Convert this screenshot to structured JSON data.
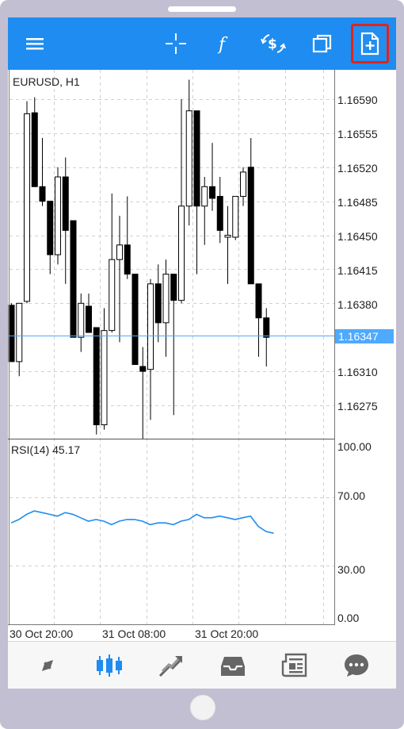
{
  "toolbar": {
    "icons": [
      "menu-icon",
      "crosshair-icon",
      "indicator-f-icon",
      "symbol-change-icon",
      "window-icon",
      "new-order-icon"
    ]
  },
  "chart": {
    "symbol_label": "EURUSD, H1",
    "rsi_label": "RSI(14) 45.17",
    "price_labels": [
      "1.16590",
      "1.16555",
      "1.16520",
      "1.16485",
      "1.16450",
      "1.16415",
      "1.16380",
      "1.16310",
      "1.16275"
    ],
    "current_price": "1.16347",
    "rsi_levels": [
      "100.00",
      "70.00",
      "30.00",
      "0.00"
    ],
    "time_labels": [
      "30 Oct 20:00",
      "31 Oct 08:00",
      "31 Oct 20:00"
    ]
  },
  "chart_data": {
    "type": "candlestick",
    "symbol": "EURUSD",
    "timeframe": "H1",
    "ylim": [
      1.1625,
      1.16615
    ],
    "current_price": 1.16347,
    "candles": [
      {
        "o": 1.16378,
        "h": 1.1638,
        "l": 1.1632,
        "c": 1.1632
      },
      {
        "o": 1.1632,
        "h": 1.1638,
        "l": 1.16305,
        "c": 1.1638
      },
      {
        "o": 1.16382,
        "h": 1.16588,
        "l": 1.1638,
        "c": 1.16575
      },
      {
        "o": 1.16576,
        "h": 1.16592,
        "l": 1.16508,
        "c": 1.165
      },
      {
        "o": 1.165,
        "h": 1.1655,
        "l": 1.1648,
        "c": 1.16485
      },
      {
        "o": 1.16485,
        "h": 1.16485,
        "l": 1.1641,
        "c": 1.1643
      },
      {
        "o": 1.1643,
        "h": 1.1652,
        "l": 1.1642,
        "c": 1.1651
      },
      {
        "o": 1.1651,
        "h": 1.1653,
        "l": 1.164,
        "c": 1.16455
      },
      {
        "o": 1.16465,
        "h": 1.16465,
        "l": 1.16345,
        "c": 1.16345
      },
      {
        "o": 1.16345,
        "h": 1.1639,
        "l": 1.1633,
        "c": 1.1638
      },
      {
        "o": 1.16377,
        "h": 1.1639,
        "l": 1.16355,
        "c": 1.1635
      },
      {
        "o": 1.16355,
        "h": 1.16355,
        "l": 1.16245,
        "c": 1.16255
      },
      {
        "o": 1.16255,
        "h": 1.16375,
        "l": 1.1625,
        "c": 1.16352
      },
      {
        "o": 1.16352,
        "h": 1.16493,
        "l": 1.1635,
        "c": 1.16425
      },
      {
        "o": 1.16425,
        "h": 1.1647,
        "l": 1.1634,
        "c": 1.1644
      },
      {
        "o": 1.1644,
        "h": 1.1649,
        "l": 1.16405,
        "c": 1.1641
      },
      {
        "o": 1.1641,
        "h": 1.1641,
        "l": 1.1632,
        "c": 1.16317
      },
      {
        "o": 1.16315,
        "h": 1.16335,
        "l": 1.1624,
        "c": 1.1631
      },
      {
        "o": 1.16312,
        "h": 1.16405,
        "l": 1.1626,
        "c": 1.164
      },
      {
        "o": 1.164,
        "h": 1.1642,
        "l": 1.1634,
        "c": 1.1636
      },
      {
        "o": 1.1636,
        "h": 1.16425,
        "l": 1.16325,
        "c": 1.1641
      },
      {
        "o": 1.1641,
        "h": 1.1641,
        "l": 1.16265,
        "c": 1.16383
      },
      {
        "o": 1.16383,
        "h": 1.1659,
        "l": 1.1638,
        "c": 1.1648
      },
      {
        "o": 1.1648,
        "h": 1.1661,
        "l": 1.1646,
        "c": 1.16578
      },
      {
        "o": 1.16578,
        "h": 1.16578,
        "l": 1.1641,
        "c": 1.1648
      },
      {
        "o": 1.1648,
        "h": 1.1651,
        "l": 1.1644,
        "c": 1.165
      },
      {
        "o": 1.165,
        "h": 1.16545,
        "l": 1.16475,
        "c": 1.16488
      },
      {
        "o": 1.1649,
        "h": 1.1651,
        "l": 1.16442,
        "c": 1.16455
      },
      {
        "o": 1.16448,
        "h": 1.1648,
        "l": 1.164,
        "c": 1.1645
      },
      {
        "o": 1.16448,
        "h": 1.1649,
        "l": 1.16445,
        "c": 1.1649
      },
      {
        "o": 1.1649,
        "h": 1.1652,
        "l": 1.1648,
        "c": 1.16515
      },
      {
        "o": 1.1652,
        "h": 1.1655,
        "l": 1.164,
        "c": 1.164
      },
      {
        "o": 1.164,
        "h": 1.164,
        "l": 1.16325,
        "c": 1.16365
      },
      {
        "o": 1.16365,
        "h": 1.16375,
        "l": 1.16315,
        "c": 1.16345
      }
    ],
    "rsi": {
      "name": "RSI(14)",
      "period": 14,
      "last_value": 45.17,
      "ylim": [
        0,
        100
      ],
      "levels": [
        70,
        30
      ],
      "values": [
        55,
        57,
        60,
        62,
        61,
        60,
        59,
        61,
        60,
        58,
        56,
        57,
        56,
        54,
        56,
        57,
        57,
        56,
        54,
        55,
        55,
        54,
        56,
        57,
        60,
        58,
        58,
        59,
        58,
        57,
        58,
        59,
        53,
        50,
        49
      ]
    },
    "time_labels": [
      "30 Oct 20:00",
      "31 Oct 08:00",
      "31 Oct 20:00"
    ]
  },
  "bottom_nav": {
    "icons": [
      "quotes-icon",
      "chart-icon",
      "trade-icon",
      "history-icon",
      "news-icon",
      "chat-icon"
    ]
  },
  "colors": {
    "toolbar": "#1e8cf0",
    "rsi_line": "#1e8cf0",
    "highlight": "#e0241c",
    "price_line": "#4ea9ff"
  }
}
